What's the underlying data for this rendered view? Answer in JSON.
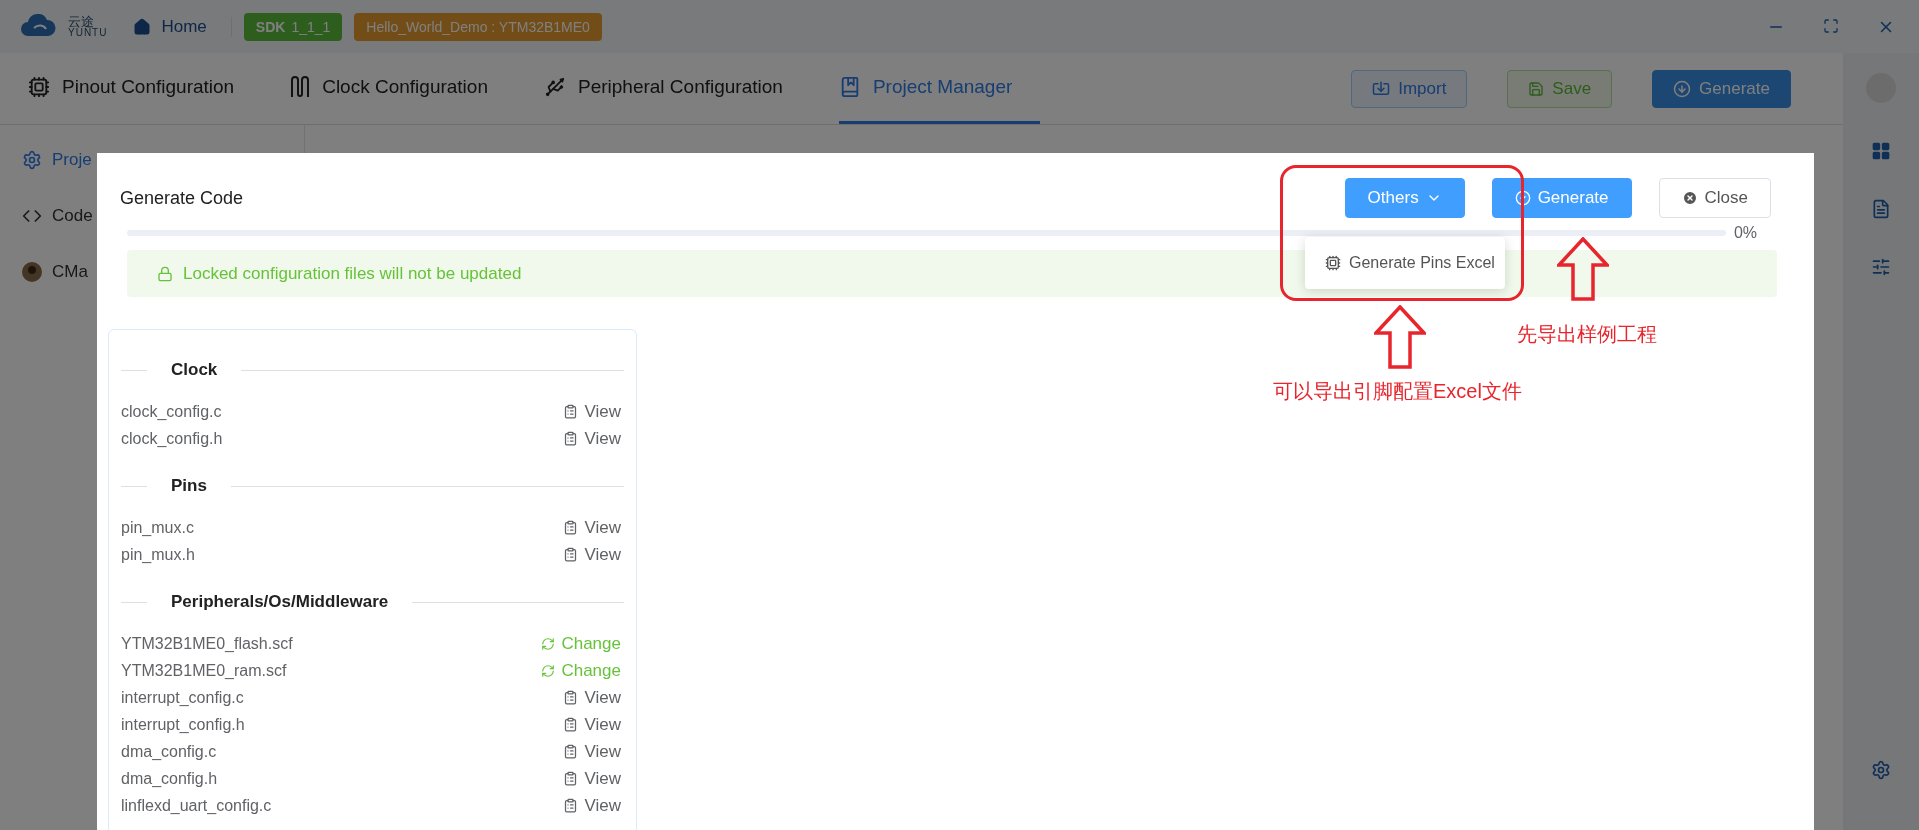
{
  "top_bar": {
    "logo_text": "云途",
    "logo_subtext": "YUNTU",
    "home": "Home",
    "badges": [
      {
        "label": "SDK",
        "text": "1_1_1",
        "kind": "sdk"
      },
      {
        "text": "Hello_World_Demo : YTM32B1ME0",
        "kind": "project"
      }
    ]
  },
  "nav_tabs": [
    {
      "label": "Pinout Configuration",
      "selected": false
    },
    {
      "label": "Clock Configuration",
      "selected": false
    },
    {
      "label": "Peripheral Configuration",
      "selected": false
    },
    {
      "label": "Project Manager",
      "selected": true
    }
  ],
  "actions": [
    {
      "label": "Import",
      "kind": "import"
    },
    {
      "label": "Save",
      "kind": "save"
    },
    {
      "label": "Generate",
      "kind": "generate"
    }
  ],
  "sidebar": {
    "items": [
      {
        "label": "Proje",
        "selected": true
      },
      {
        "label": "Code",
        "selected": false
      },
      {
        "label": "CMa",
        "selected": false
      }
    ]
  },
  "dialog": {
    "title": "Generate Code",
    "buttons": [
      {
        "label": "Others",
        "kind": "dropdown"
      },
      {
        "label": "Generate",
        "kind": "primary"
      },
      {
        "label": "Close",
        "kind": "close"
      }
    ],
    "progress": {
      "level": 0,
      "reading": "0%"
    },
    "alert": "Locked configuration files will not be updated",
    "menu": [
      {
        "label": "Generate Pins Excel"
      }
    ],
    "sections": [
      {
        "title": "Clock",
        "files": [
          {
            "name": "clock_config.c",
            "action": "View",
            "kind": "view"
          },
          {
            "name": "clock_config.h",
            "action": "View",
            "kind": "view"
          }
        ]
      },
      {
        "title": "Pins",
        "files": [
          {
            "name": "pin_mux.c",
            "action": "View",
            "kind": "view"
          },
          {
            "name": "pin_mux.h",
            "action": "View",
            "kind": "view"
          }
        ]
      },
      {
        "title": "Peripherals/Os/Middleware",
        "files": [
          {
            "name": "YTM32B1ME0_flash.scf",
            "action": "Change",
            "kind": "change"
          },
          {
            "name": "YTM32B1ME0_ram.scf",
            "action": "Change",
            "kind": "change"
          },
          {
            "name": "interrupt_config.c",
            "action": "View",
            "kind": "view"
          },
          {
            "name": "interrupt_config.h",
            "action": "View",
            "kind": "view"
          },
          {
            "name": "dma_config.c",
            "action": "View",
            "kind": "view"
          },
          {
            "name": "dma_config.h",
            "action": "View",
            "kind": "view"
          },
          {
            "name": "linflexd_uart_config.c",
            "action": "View",
            "kind": "view"
          }
        ]
      }
    ]
  },
  "annotations": [
    {
      "text": "先导出样例工程"
    },
    {
      "text": "可以导出引脚配置Excel文件"
    }
  ]
}
